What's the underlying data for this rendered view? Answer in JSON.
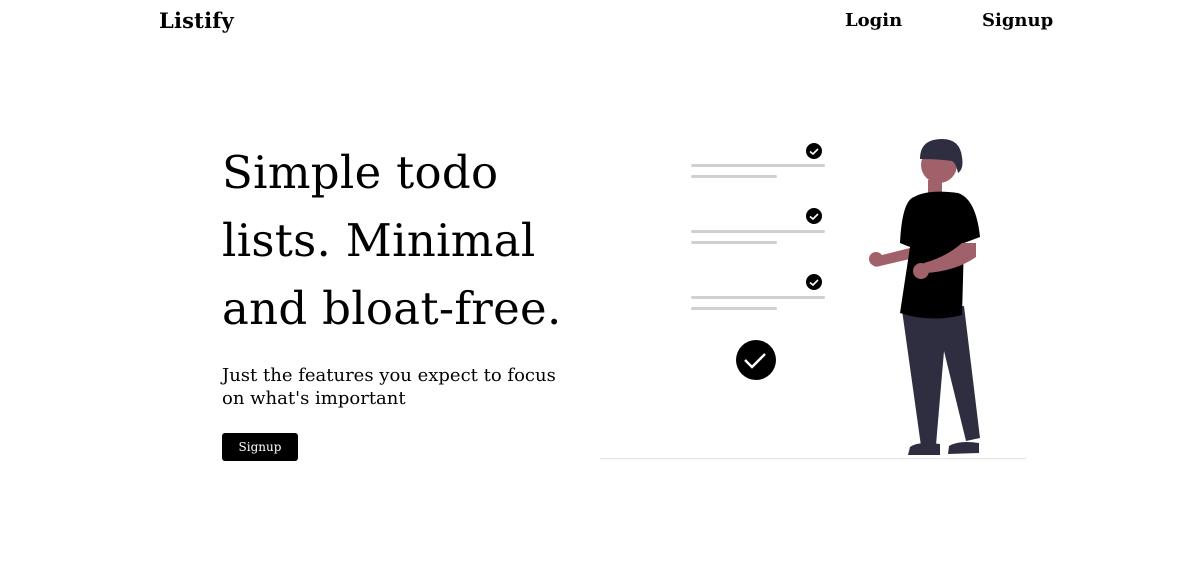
{
  "nav": {
    "brand": "Listify",
    "links": [
      {
        "label": "Login"
      },
      {
        "label": "Signup"
      }
    ]
  },
  "hero": {
    "title": "Simple todo lists. Minimal and bloat-free.",
    "subtitle": "Just the features you expect to focus on what's important",
    "cta_label": "Signup"
  },
  "illustration": {
    "name": "person-with-checklist",
    "colors": {
      "line": "#d0d0d0",
      "check": "#000000",
      "shirt": "#000000",
      "skin": "#a0616a",
      "hair": "#2f2e41",
      "pants": "#2f2e41",
      "ground": "#e6e6e6"
    }
  }
}
